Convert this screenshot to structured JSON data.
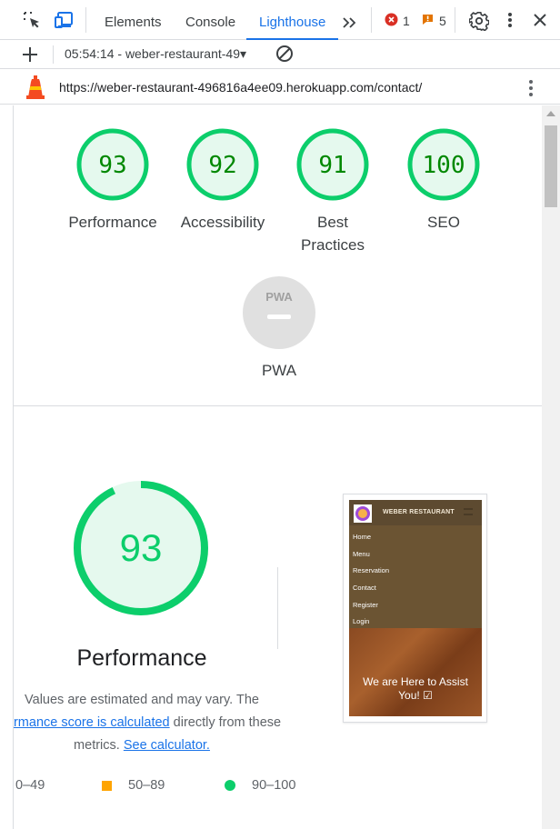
{
  "devtools": {
    "tabs": [
      "Elements",
      "Console",
      "Lighthouse"
    ],
    "more_tabs": "»",
    "error_count": "1",
    "warning_count": "5"
  },
  "toolbar": {
    "report_select": "05:54:14 - weber-restaurant-49▾"
  },
  "urlbar": {
    "url": "https://weber-restaurant-496816a4ee09.herokuapp.com/contact/"
  },
  "scores": [
    {
      "value": "93",
      "label": "Performance",
      "score": 93
    },
    {
      "value": "92",
      "label": "Accessibility",
      "score": 92
    },
    {
      "value": "91",
      "label": "Best Practices",
      "score": 91
    },
    {
      "value": "100",
      "label": "SEO",
      "score": 100
    }
  ],
  "pwa": {
    "badge": "PWA",
    "label": "PWA"
  },
  "performance": {
    "score": "93",
    "title": "Performance",
    "desc_line1": "Values are estimated and may vary. The",
    "desc_link": "formance score is calculated",
    "desc_mid": " directly from these",
    "desc_line3": "metrics.",
    "desc_link2": "See calculator."
  },
  "legend": [
    {
      "range": "0–49",
      "color": "#ff4e42"
    },
    {
      "range": "50–89",
      "color": "#ffa400"
    },
    {
      "range": "90–100",
      "color": "#0cce6b"
    }
  ],
  "screenshot": {
    "brand": "WEBER RESTAURANT",
    "nav": [
      "Home",
      "Menu",
      "Reservation",
      "Contact",
      "Register",
      "Login"
    ],
    "hero_line1": "We are Here to Assist",
    "hero_line2": "You! ☑"
  },
  "colors": {
    "pass": "#0cce6b",
    "pass_text": "#008800",
    "pass_fill": "#e5f9ee",
    "accent": "#1a73e8"
  }
}
